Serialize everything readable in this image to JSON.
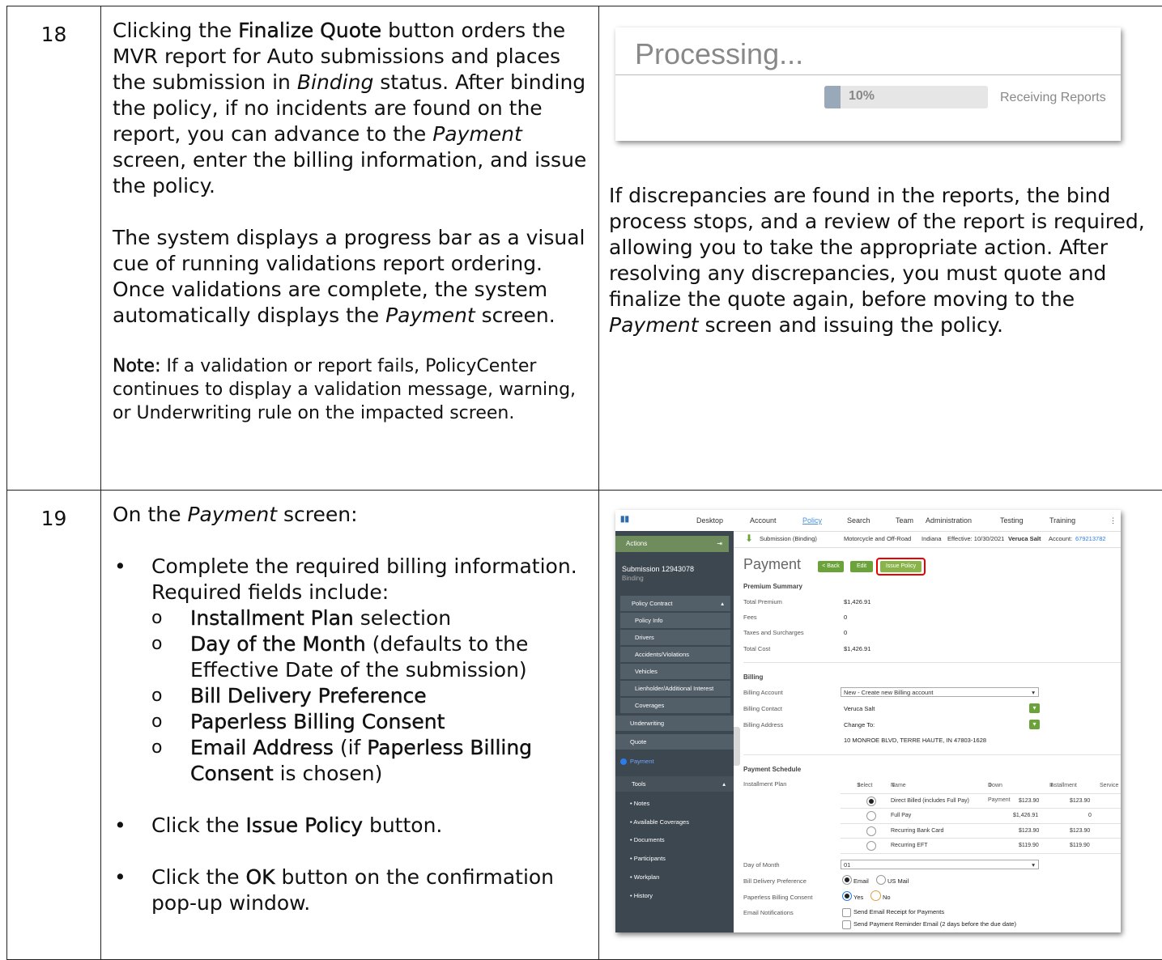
{
  "rows": [
    {
      "number": "18",
      "para1_a": "Clicking the ",
      "para1_b": "Finalize Quote",
      "para1_c": " button orders the MVR report for Auto submissions and places the submission in ",
      "para1_d": "Binding",
      "para1_e": " status. After binding the policy, if no incidents are found on the report, you can advance to the ",
      "para1_f": "Payment",
      "para1_g": " screen, enter the billing information, and issue the policy.",
      "para2_a": "The system displays a progress bar as a visual cue of running validations report ordering. Once validations are complete, the system automatically displays the ",
      "para2_b": "Payment",
      "para2_c": " screen.",
      "note_label": "Note:",
      "note_text": " If a validation or report fails, PolicyCenter continues to display a validation message, warning, or Underwriting rule on the impacted screen.",
      "processing": {
        "title": "Processing...",
        "progress_label": "10%",
        "progress_value": 0.1,
        "status": "Receiving Reports"
      },
      "right_a": "If discrepancies are found in the reports, the bind process stops, and a review of the report is required, allowing you to take the appropriate action. After resolving any discrepancies, you must quote and finalize the quote again, before moving to the ",
      "right_b": "Payment",
      "right_c": " screen and issuing the policy."
    },
    {
      "number": "19",
      "intro_a": "On the ",
      "intro_b": "Payment",
      "intro_c": " screen:",
      "bullet1": "Complete the required billing information. Required fields include:",
      "sub": [
        {
          "bold": "Installment Plan",
          "rest": " selection"
        },
        {
          "bold": "Day of the Month",
          "rest": " (defaults to the Effective Date of the submission)"
        },
        {
          "bold": "Bill Delivery Preference",
          "rest": ""
        },
        {
          "bold": "Paperless Billing Consent",
          "rest": ""
        },
        {
          "bold": "Email Address",
          "rest": " (if ",
          "bold2": "Paperless Billing Consent",
          "rest2": " is chosen)"
        }
      ],
      "bullet2_a": "Click the ",
      "bullet2_b": "Issue Policy",
      "bullet2_c": " button.",
      "bullet3_a": "Click the ",
      "bullet3_b": "OK",
      "bullet3_c": " button on the confirmation pop-up window."
    }
  ],
  "app": {
    "nav": [
      "Desktop",
      "Account",
      "Policy",
      "Search",
      "Team",
      "Administration",
      "Testing",
      "Training"
    ],
    "actions": "Actions",
    "submission": "Submission 12943078",
    "submission_status": "Binding",
    "side_items": [
      "Policy Contract",
      "Policy Info",
      "Drivers",
      "Accidents/Violations",
      "Vehicles",
      "Lienholder/Additional Interest",
      "Coverages",
      "Underwriting",
      "Quote",
      "Payment"
    ],
    "tools": "Tools",
    "tool_items": [
      "Notes",
      "Available Coverages",
      "Documents",
      "Participants",
      "Workplan",
      "History"
    ],
    "crumb": "Submission (Binding)",
    "crumb_lob": "Motorcycle and Off-Road",
    "crumb_state": "Indiana",
    "crumb_eff": "Effective: 10/30/2021",
    "crumb_insured": "Veruca Salt",
    "crumb_account_label": "Account:",
    "crumb_account": "679213782",
    "page_title": "Payment",
    "btn_back": "< Back",
    "btn_edit": "Edit",
    "btn_issue": "Issue Policy",
    "premium_summary": "Premium Summary",
    "premium_rows": [
      {
        "label": "Total Premium",
        "value": "$1,426.91"
      },
      {
        "label": "Fees",
        "value": "0"
      },
      {
        "label": "Taxes and Surcharges",
        "value": "0"
      },
      {
        "label": "Total Cost",
        "value": "$1,426.91"
      }
    ],
    "billing": "Billing",
    "billing_account_label": "Billing Account",
    "billing_account": "New - Create new Billing account",
    "billing_contact_label": "Billing Contact",
    "billing_contact": "Veruca Salt",
    "billing_address_label": "Billing Address",
    "billing_address_change": "Change To:",
    "billing_address": "10 MONROE BLVD, TERRE HAUTE, IN 47803-1628",
    "payment_schedule": "Payment Schedule",
    "installment_plan": "Installment Plan",
    "grid_headers": [
      "Select",
      "Name",
      "Down Payment",
      "Installment",
      "Service"
    ],
    "grid_rows": [
      {
        "name": "Direct Billed (includes Full Pay)",
        "down": "$123.90",
        "inst": "$123.90",
        "selected": true
      },
      {
        "name": "Full Pay",
        "down": "$1,426.91",
        "inst": "0",
        "selected": false
      },
      {
        "name": "Recurring Bank Card",
        "down": "$123.90",
        "inst": "$123.90",
        "selected": false
      },
      {
        "name": "Recurring EFT",
        "down": "$119.90",
        "inst": "$119.90",
        "selected": false
      }
    ],
    "day_of_month_label": "Day of Month",
    "day_of_month": "01",
    "bill_delivery_label": "Bill Delivery Preference",
    "bill_delivery_options": [
      "Email",
      "US Mail"
    ],
    "paperless_label": "Paperless Billing Consent",
    "paperless_options": [
      "Yes",
      "No"
    ],
    "email_notifications_label": "Email Notifications",
    "email_notifications": [
      "Send Email Receipt for Payments",
      "Send Payment Reminder Email (2 days before the due date)"
    ],
    "accent": "#6ba33a",
    "highlight": "#e00000"
  }
}
